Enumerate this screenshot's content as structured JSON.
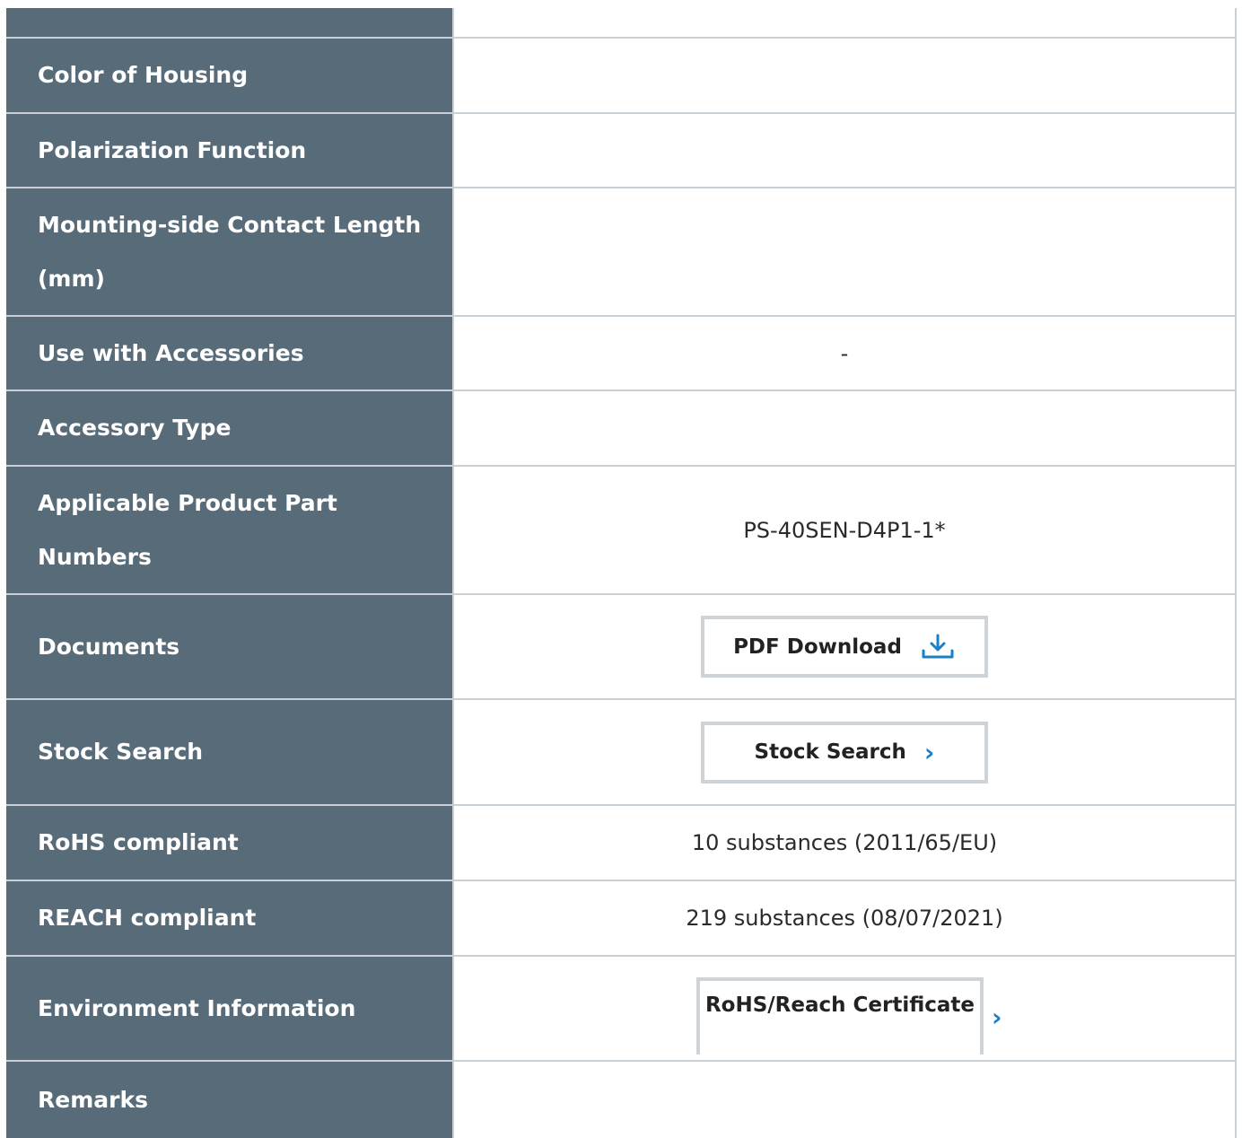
{
  "table": {
    "rows": [
      {
        "label": "",
        "value": ""
      },
      {
        "label": "Color of Housing",
        "value": ""
      },
      {
        "label": "Polarization Function",
        "value": ""
      },
      {
        "label": "Mounting-side Contact Length (mm)",
        "value": ""
      },
      {
        "label": "Use with Accessories",
        "value": "-"
      },
      {
        "label": "Accessory Type",
        "value": ""
      },
      {
        "label": "Applicable Product Part Numbers",
        "value": "PS-40SEN-D4P1-1*"
      },
      {
        "label": "Documents",
        "button_label": "PDF Download"
      },
      {
        "label": "Stock Search",
        "button_label": "Stock Search"
      },
      {
        "label": "RoHS compliant",
        "value": "10 substances (2011/65/EU)"
      },
      {
        "label": "REACH compliant",
        "value": "219 substances (08/07/2021)"
      },
      {
        "label": "Environment Information",
        "button_label": "RoHS/Reach Certificate"
      },
      {
        "label": "Remarks",
        "value": ""
      }
    ]
  },
  "colors": {
    "header_bg": "#586b78",
    "border": "#c7d0d6",
    "accent": "#1a7fc4"
  },
  "icons": {
    "download": "download-icon",
    "chevron": "chevron-right-icon"
  }
}
